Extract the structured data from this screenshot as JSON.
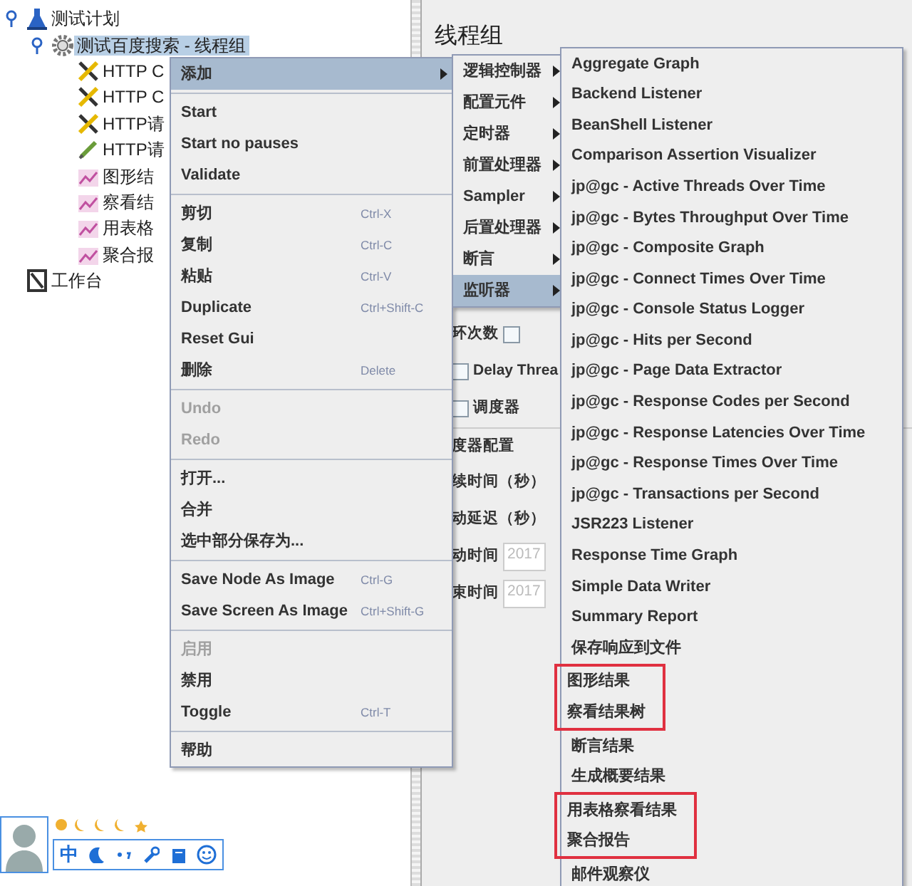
{
  "tree": [
    {
      "label": "测试计划",
      "kind": "plan",
      "selected": false,
      "expanded": true,
      "children": [
        {
          "label": "测试百度搜索 - 线程组",
          "kind": "thread_group",
          "selected": true,
          "expanded": true,
          "children": [
            {
              "label": "HTTP C",
              "kind": "config",
              "selected": false
            },
            {
              "label": "HTTP C",
              "kind": "config",
              "selected": false
            },
            {
              "label": "HTTP请",
              "kind": "config",
              "selected": false
            },
            {
              "label": "HTTP请",
              "kind": "sampler",
              "selected": false
            },
            {
              "label": "图形结",
              "kind": "listener",
              "selected": false
            },
            {
              "label": "察看结",
              "kind": "listener",
              "selected": false
            },
            {
              "label": "用表格",
              "kind": "listener",
              "selected": false
            },
            {
              "label": "聚合报",
              "kind": "listener",
              "selected": false
            }
          ]
        }
      ]
    },
    {
      "label": "工作台",
      "kind": "workbench",
      "selected": false
    }
  ],
  "panel": {
    "title": "线程组",
    "rows": [
      {
        "kind": "label",
        "label": "环次数",
        "checkbox": true,
        "checked": false
      },
      {
        "kind": "check",
        "label": "Delay Threa",
        "checked": false
      },
      {
        "kind": "check",
        "label": "调度器",
        "checked": false
      },
      {
        "kind": "heading",
        "label": "度器配置"
      },
      {
        "kind": "label",
        "label": "续时间（秒）"
      },
      {
        "kind": "label",
        "label": "动延迟（秒）"
      },
      {
        "kind": "field",
        "label": "动时间",
        "value": "2017"
      },
      {
        "kind": "field",
        "label": "束时间",
        "value": "2017"
      }
    ]
  },
  "menus": [
    {
      "groups": [
        [
          {
            "label": "添加",
            "kind": "submenu",
            "selected": true,
            "disabled": false
          }
        ],
        [
          {
            "label": "Start",
            "kind": "action",
            "selected": false,
            "disabled": false
          },
          {
            "label": "Start no pauses",
            "kind": "action",
            "selected": false,
            "disabled": false
          },
          {
            "label": "Validate",
            "kind": "action",
            "selected": false,
            "disabled": false
          }
        ],
        [
          {
            "label": "剪切",
            "shortcut": "Ctrl-X",
            "kind": "action",
            "selected": false,
            "disabled": false
          },
          {
            "label": "复制",
            "shortcut": "Ctrl-C",
            "kind": "action",
            "selected": false,
            "disabled": false
          },
          {
            "label": "粘贴",
            "shortcut": "Ctrl-V",
            "kind": "action",
            "selected": false,
            "disabled": false
          },
          {
            "label": "Duplicate",
            "shortcut": "Ctrl+Shift-C",
            "kind": "action",
            "selected": false,
            "disabled": false
          },
          {
            "label": "Reset Gui",
            "kind": "action",
            "selected": false,
            "disabled": false
          },
          {
            "label": "删除",
            "shortcut": "Delete",
            "kind": "action",
            "selected": false,
            "disabled": false
          }
        ],
        [
          {
            "label": "Undo",
            "kind": "action",
            "selected": false,
            "disabled": true
          },
          {
            "label": "Redo",
            "kind": "action",
            "selected": false,
            "disabled": true
          }
        ],
        [
          {
            "label": "打开...",
            "kind": "action",
            "selected": false,
            "disabled": false
          },
          {
            "label": "合并",
            "kind": "action",
            "selected": false,
            "disabled": false
          },
          {
            "label": "选中部分保存为...",
            "kind": "action",
            "selected": false,
            "disabled": false
          }
        ],
        [
          {
            "label": "Save Node As Image",
            "shortcut": "Ctrl-G",
            "kind": "action",
            "selected": false,
            "disabled": false
          },
          {
            "label": "Save Screen As Image",
            "shortcut": "Ctrl+Shift-G",
            "kind": "action",
            "selected": false,
            "disabled": false
          }
        ],
        [
          {
            "label": "启用",
            "kind": "action",
            "selected": false,
            "disabled": true
          },
          {
            "label": "禁用",
            "kind": "action",
            "selected": false,
            "disabled": false
          },
          {
            "label": "Toggle",
            "shortcut": "Ctrl-T",
            "kind": "action",
            "selected": false,
            "disabled": false
          }
        ],
        [
          {
            "label": "帮助",
            "kind": "action",
            "selected": false,
            "disabled": false
          }
        ]
      ]
    },
    {
      "items": [
        {
          "label": "逻辑控制器",
          "selected": false
        },
        {
          "label": "配置元件",
          "selected": false
        },
        {
          "label": "定时器",
          "selected": false
        },
        {
          "label": "前置处理器",
          "selected": false
        },
        {
          "label": "Sampler",
          "selected": false
        },
        {
          "label": "后置处理器",
          "selected": false
        },
        {
          "label": "断言",
          "selected": false
        },
        {
          "label": "监听器",
          "selected": true
        }
      ]
    },
    {
      "items": [
        {
          "label": "Aggregate Graph",
          "highlighted": false
        },
        {
          "label": "Backend Listener",
          "highlighted": false
        },
        {
          "label": "BeanShell Listener",
          "highlighted": false
        },
        {
          "label": "Comparison Assertion Visualizer",
          "highlighted": false
        },
        {
          "label": "jp@gc - Active Threads Over Time",
          "highlighted": false
        },
        {
          "label": "jp@gc - Bytes Throughput Over Time",
          "highlighted": false
        },
        {
          "label": "jp@gc - Composite Graph",
          "highlighted": false
        },
        {
          "label": "jp@gc - Connect Times Over Time",
          "highlighted": false
        },
        {
          "label": "jp@gc - Console Status Logger",
          "highlighted": false
        },
        {
          "label": "jp@gc - Hits per Second",
          "highlighted": false
        },
        {
          "label": "jp@gc - Page Data Extractor",
          "highlighted": false
        },
        {
          "label": "jp@gc - Response Codes per Second",
          "highlighted": false
        },
        {
          "label": "jp@gc - Response Latencies Over Time",
          "highlighted": false
        },
        {
          "label": "jp@gc - Response Times Over Time",
          "highlighted": false
        },
        {
          "label": "jp@gc - Transactions per Second",
          "highlighted": false
        },
        {
          "label": "JSR223 Listener",
          "highlighted": false
        },
        {
          "label": "Response Time Graph",
          "highlighted": false
        },
        {
          "label": "Simple Data Writer",
          "highlighted": false
        },
        {
          "label": "Summary Report",
          "highlighted": false
        },
        {
          "label": "保存响应到文件",
          "highlighted": false
        },
        {
          "label": "图形结果",
          "highlighted": true
        },
        {
          "label": "察看结果树",
          "highlighted": true
        },
        {
          "label": "断言结果",
          "highlighted": false
        },
        {
          "label": "生成概要结果",
          "highlighted": false
        },
        {
          "label": "用表格察看结果",
          "highlighted": true
        },
        {
          "label": "聚合报告",
          "highlighted": true
        },
        {
          "label": "邮件观察仪",
          "highlighted": false
        }
      ]
    }
  ],
  "ime_bar": {
    "mode_label": "中"
  }
}
